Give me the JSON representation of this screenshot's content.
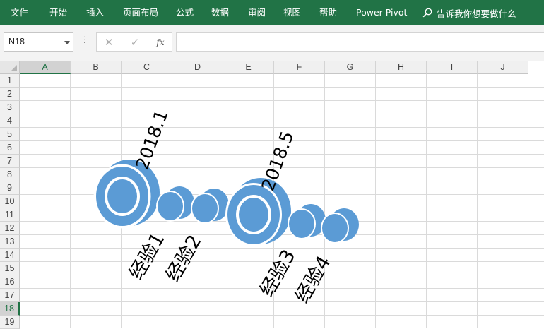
{
  "ribbon": {
    "tabs": [
      "文件",
      "开始",
      "插入",
      "页面布局",
      "公式",
      "数据",
      "审阅",
      "视图",
      "帮助",
      "Power Pivot"
    ],
    "tell_me": "告诉我你想要做什么"
  },
  "formula_bar": {
    "name_box": "N18",
    "cancel_symbol": "✕",
    "enter_symbol": "✓",
    "fx_symbol": "fx",
    "formula": ""
  },
  "grid": {
    "columns": [
      "A",
      "B",
      "C",
      "D",
      "E",
      "F",
      "G",
      "H",
      "I",
      "J"
    ],
    "rows": [
      "1",
      "2",
      "3",
      "4",
      "5",
      "6",
      "7",
      "8",
      "9",
      "10",
      "11",
      "12",
      "13",
      "14",
      "15",
      "16",
      "17",
      "18",
      "19"
    ],
    "selected_column": "A",
    "selected_row": "18"
  },
  "timeline": {
    "accent_color": "#5b9bd5",
    "dates": [
      "2018.1",
      "2018.5"
    ],
    "experiences": [
      "经验1",
      "经验2",
      "经验3",
      "经验4"
    ]
  }
}
